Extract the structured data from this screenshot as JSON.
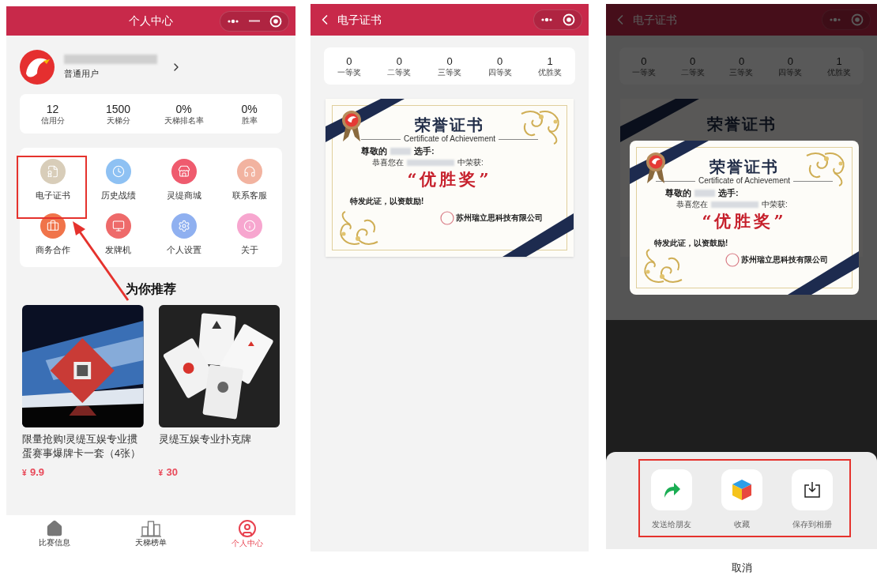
{
  "profile_screen": {
    "title": "个人中心",
    "user": {
      "role": "普通用户"
    },
    "stats": [
      {
        "value": "12",
        "label": "信用分"
      },
      {
        "value": "1500",
        "label": "天梯分"
      },
      {
        "value": "0%",
        "label": "天梯排名率"
      },
      {
        "value": "0%",
        "label": "胜率"
      }
    ],
    "menu": [
      {
        "label": "电子证书",
        "color": "#d8cdb9"
      },
      {
        "label": "历史战绩",
        "color": "#8ec1f3"
      },
      {
        "label": "灵缇商城",
        "color": "#ef5b6e"
      },
      {
        "label": "联系客服",
        "color": "#f2b3a0"
      },
      {
        "label": "商务合作",
        "color": "#f0744a"
      },
      {
        "label": "发牌机",
        "color": "#ee6a6a"
      },
      {
        "label": "个人设置",
        "color": "#8fb0f0"
      },
      {
        "label": "关于",
        "color": "#f7a6cf"
      }
    ],
    "section_title": "为你推荐",
    "products": [
      {
        "title": "限量抢购!灵缇互娱专业掼蛋赛事爆牌卡一套（4张）",
        "currency": "¥",
        "amount": "9.9"
      },
      {
        "title": "灵缇互娱专业扑克牌",
        "currency": "¥",
        "amount": "30"
      }
    ],
    "tab_bar": [
      {
        "label": "比赛信息",
        "selected": false
      },
      {
        "label": "天梯榜单",
        "selected": false
      },
      {
        "label": "个人中心",
        "selected": true
      }
    ]
  },
  "certificate_screen": {
    "title": "电子证书",
    "awards": [
      {
        "count": "0",
        "label": "一等奖"
      },
      {
        "count": "0",
        "label": "二等奖"
      },
      {
        "count": "0",
        "label": "三等奖"
      },
      {
        "count": "0",
        "label": "四等奖"
      },
      {
        "count": "1",
        "label": "优胜奖"
      }
    ],
    "certificate": {
      "title": "荣誉证书",
      "subtitle": "Certificate of Achievement",
      "salutation": "尊敬的",
      "salutation_suffix": "选手:",
      "event_prefix": "恭喜您在",
      "event_suffix": "中荣获:",
      "award": "“优胜奖”",
      "closing": "特发此证，以资鼓励!",
      "issuer": "苏州瑞立思科技有限公司"
    }
  },
  "share_screen": {
    "title": "电子证书",
    "awards": [
      {
        "count": "0",
        "label": "一等奖"
      },
      {
        "count": "0",
        "label": "二等奖"
      },
      {
        "count": "0",
        "label": "三等奖"
      },
      {
        "count": "0",
        "label": "四等奖"
      },
      {
        "count": "1",
        "label": "优胜奖"
      }
    ],
    "background_certificate_title": "荣誉证书",
    "certificate": {
      "title": "荣誉证书",
      "subtitle": "Certificate of Achievement",
      "salutation": "尊敬的",
      "salutation_suffix": "选手:",
      "event_prefix": "恭喜您在",
      "event_suffix": "中荣获:",
      "award": "“优胜奖”",
      "closing": "特发此证，以资鼓励!",
      "issuer": "苏州瑞立思科技有限公司"
    },
    "actions": [
      {
        "label": "发送给朋友"
      },
      {
        "label": "收藏"
      },
      {
        "label": "保存到相册"
      }
    ],
    "cancel": "取消"
  }
}
